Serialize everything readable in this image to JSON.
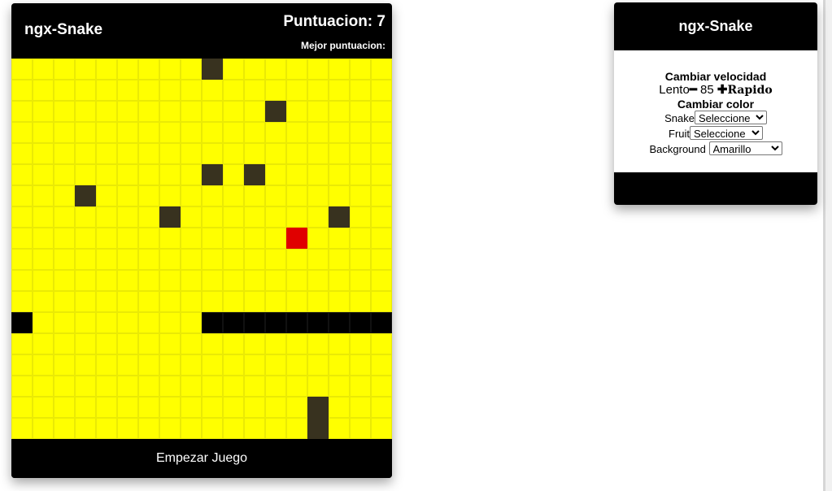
{
  "game": {
    "title": "ngx-Snake",
    "score_label": "Puntuacion:",
    "score": "7",
    "best_label": "Mejor puntuacion:",
    "best": "",
    "start_button": "Empezar Juego",
    "board": {
      "rows": [
        ".........O........",
        "..................",
        "............O.....",
        "..................",
        "..................",
        ".........O.O......",
        "...O..............",
        ".......O.......O..",
        ".............F....",
        "..................",
        "..................",
        "..................",
        "S........SSSSSSSSS",
        "..................",
        "..................",
        "..................",
        "..............O...",
        "..............O..."
      ]
    },
    "colors": {
      "board": "#ffff00",
      "obstacle": "#38321f",
      "snake": "#000000",
      "fruit": "#e00000"
    }
  },
  "settings": {
    "title": "ngx-Snake",
    "speed_title": "Cambiar velocidad",
    "speed_slow": "Lento",
    "speed_minus": "━",
    "speed_value": "85",
    "speed_plus": "✚",
    "speed_fast": "Rapido",
    "color_title": "Cambiar color",
    "snake_label": "Snake",
    "snake_value": "Seleccione",
    "fruit_label": "Fruit",
    "fruit_value": "Seleccione",
    "background_label": "Background",
    "background_value": "Amarillo"
  }
}
